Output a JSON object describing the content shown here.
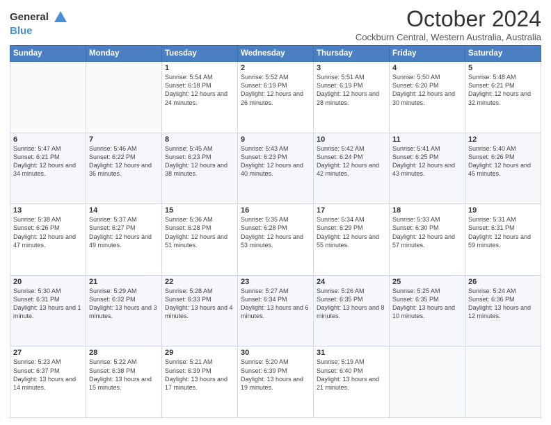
{
  "logo": {
    "general": "General",
    "blue": "Blue"
  },
  "title": "October 2024",
  "subtitle": "Cockburn Central, Western Australia, Australia",
  "days_of_week": [
    "Sunday",
    "Monday",
    "Tuesday",
    "Wednesday",
    "Thursday",
    "Friday",
    "Saturday"
  ],
  "weeks": [
    [
      {
        "day": "",
        "info": ""
      },
      {
        "day": "",
        "info": ""
      },
      {
        "day": "1",
        "info": "Sunrise: 5:54 AM\nSunset: 6:18 PM\nDaylight: 12 hours and 24 minutes."
      },
      {
        "day": "2",
        "info": "Sunrise: 5:52 AM\nSunset: 6:19 PM\nDaylight: 12 hours and 26 minutes."
      },
      {
        "day": "3",
        "info": "Sunrise: 5:51 AM\nSunset: 6:19 PM\nDaylight: 12 hours and 28 minutes."
      },
      {
        "day": "4",
        "info": "Sunrise: 5:50 AM\nSunset: 6:20 PM\nDaylight: 12 hours and 30 minutes."
      },
      {
        "day": "5",
        "info": "Sunrise: 5:48 AM\nSunset: 6:21 PM\nDaylight: 12 hours and 32 minutes."
      }
    ],
    [
      {
        "day": "6",
        "info": "Sunrise: 5:47 AM\nSunset: 6:21 PM\nDaylight: 12 hours and 34 minutes."
      },
      {
        "day": "7",
        "info": "Sunrise: 5:46 AM\nSunset: 6:22 PM\nDaylight: 12 hours and 36 minutes."
      },
      {
        "day": "8",
        "info": "Sunrise: 5:45 AM\nSunset: 6:23 PM\nDaylight: 12 hours and 38 minutes."
      },
      {
        "day": "9",
        "info": "Sunrise: 5:43 AM\nSunset: 6:23 PM\nDaylight: 12 hours and 40 minutes."
      },
      {
        "day": "10",
        "info": "Sunrise: 5:42 AM\nSunset: 6:24 PM\nDaylight: 12 hours and 42 minutes."
      },
      {
        "day": "11",
        "info": "Sunrise: 5:41 AM\nSunset: 6:25 PM\nDaylight: 12 hours and 43 minutes."
      },
      {
        "day": "12",
        "info": "Sunrise: 5:40 AM\nSunset: 6:26 PM\nDaylight: 12 hours and 45 minutes."
      }
    ],
    [
      {
        "day": "13",
        "info": "Sunrise: 5:38 AM\nSunset: 6:26 PM\nDaylight: 12 hours and 47 minutes."
      },
      {
        "day": "14",
        "info": "Sunrise: 5:37 AM\nSunset: 6:27 PM\nDaylight: 12 hours and 49 minutes."
      },
      {
        "day": "15",
        "info": "Sunrise: 5:36 AM\nSunset: 6:28 PM\nDaylight: 12 hours and 51 minutes."
      },
      {
        "day": "16",
        "info": "Sunrise: 5:35 AM\nSunset: 6:28 PM\nDaylight: 12 hours and 53 minutes."
      },
      {
        "day": "17",
        "info": "Sunrise: 5:34 AM\nSunset: 6:29 PM\nDaylight: 12 hours and 55 minutes."
      },
      {
        "day": "18",
        "info": "Sunrise: 5:33 AM\nSunset: 6:30 PM\nDaylight: 12 hours and 57 minutes."
      },
      {
        "day": "19",
        "info": "Sunrise: 5:31 AM\nSunset: 6:31 PM\nDaylight: 12 hours and 59 minutes."
      }
    ],
    [
      {
        "day": "20",
        "info": "Sunrise: 5:30 AM\nSunset: 6:31 PM\nDaylight: 13 hours and 1 minute."
      },
      {
        "day": "21",
        "info": "Sunrise: 5:29 AM\nSunset: 6:32 PM\nDaylight: 13 hours and 3 minutes."
      },
      {
        "day": "22",
        "info": "Sunrise: 5:28 AM\nSunset: 6:33 PM\nDaylight: 13 hours and 4 minutes."
      },
      {
        "day": "23",
        "info": "Sunrise: 5:27 AM\nSunset: 6:34 PM\nDaylight: 13 hours and 6 minutes."
      },
      {
        "day": "24",
        "info": "Sunrise: 5:26 AM\nSunset: 6:35 PM\nDaylight: 13 hours and 8 minutes."
      },
      {
        "day": "25",
        "info": "Sunrise: 5:25 AM\nSunset: 6:35 PM\nDaylight: 13 hours and 10 minutes."
      },
      {
        "day": "26",
        "info": "Sunrise: 5:24 AM\nSunset: 6:36 PM\nDaylight: 13 hours and 12 minutes."
      }
    ],
    [
      {
        "day": "27",
        "info": "Sunrise: 5:23 AM\nSunset: 6:37 PM\nDaylight: 13 hours and 14 minutes."
      },
      {
        "day": "28",
        "info": "Sunrise: 5:22 AM\nSunset: 6:38 PM\nDaylight: 13 hours and 15 minutes."
      },
      {
        "day": "29",
        "info": "Sunrise: 5:21 AM\nSunset: 6:39 PM\nDaylight: 13 hours and 17 minutes."
      },
      {
        "day": "30",
        "info": "Sunrise: 5:20 AM\nSunset: 6:39 PM\nDaylight: 13 hours and 19 minutes."
      },
      {
        "day": "31",
        "info": "Sunrise: 5:19 AM\nSunset: 6:40 PM\nDaylight: 13 hours and 21 minutes."
      },
      {
        "day": "",
        "info": ""
      },
      {
        "day": "",
        "info": ""
      }
    ]
  ]
}
